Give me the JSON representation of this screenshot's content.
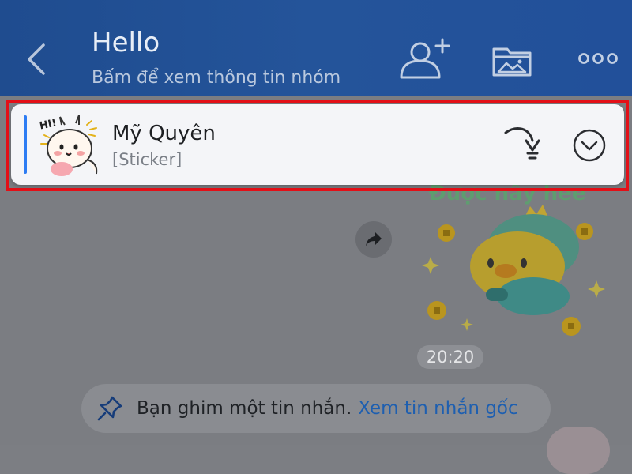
{
  "header": {
    "title": "Hello",
    "subtitle": "Bấm để xem thông tin nhóm",
    "icons": [
      "back-icon",
      "add-member-icon",
      "media-folder-icon",
      "more-icon"
    ]
  },
  "pinned": {
    "sender": "Mỹ Quyên",
    "message_type": "[Sticker]",
    "icons": [
      "sticker-thumbnail",
      "jump-to-message-icon",
      "expand-chevron-icon"
    ]
  },
  "chat": {
    "message_time": "20:20",
    "sticker_caption": "Được nầy hee",
    "pin_notice_text": "Bạn ghim một tin nhắn.",
    "pin_notice_link": "Xem tin nhắn gốc"
  },
  "colors": {
    "header": "#22509a",
    "overlay": "#7b7d82",
    "card": "#f4f5f8",
    "highlight": "#e30f17",
    "accent": "#2d7cf3",
    "link": "#1e5fb0"
  }
}
